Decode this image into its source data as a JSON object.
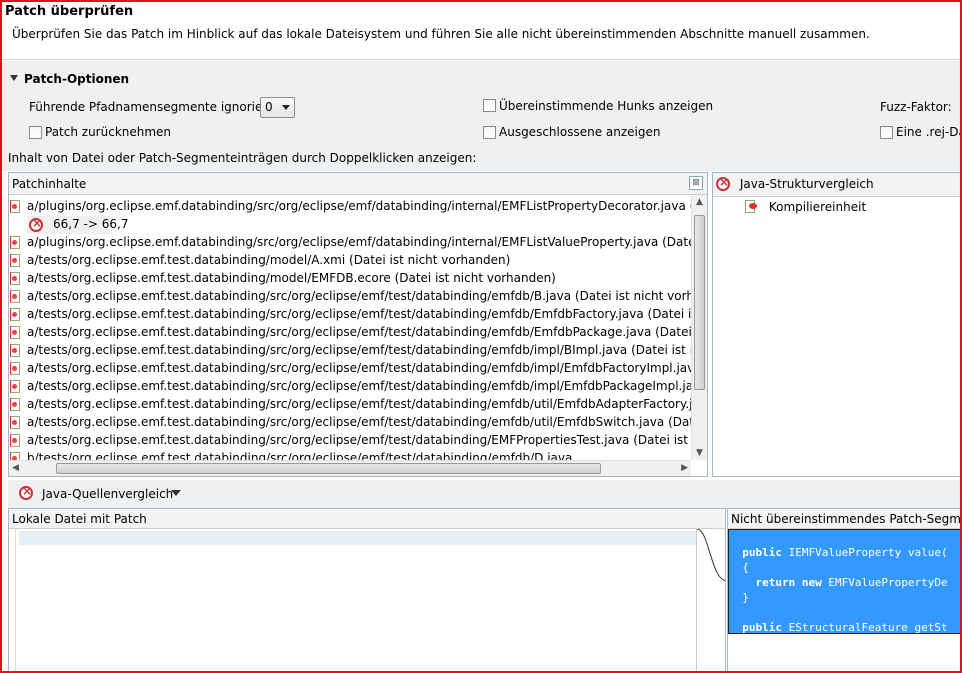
{
  "header": {
    "title": "Patch überprüfen",
    "description": "Überprüfen Sie das Patch im Hinblick auf das lokale Dateisystem und führen Sie alle nicht übereinstimmenden Abschnitte manuell zusammen."
  },
  "options": {
    "section_label": "Patch-Optionen",
    "strip_label": "Führende Pfadnamensegmente ignorieren:",
    "strip_value": "0",
    "show_matching_label": "Übereinstimmende Hunks anzeigen",
    "fuzz_label": "Fuzz-Faktor:",
    "reverse_label": "Patch zurücknehmen",
    "show_excluded_label": "Ausgeschlossene anzeigen",
    "rej_label": "Eine .rej-Date",
    "hint": "Inhalt von Datei oder Patch-Segmenteinträgen durch Doppelklicken anzeigen:"
  },
  "patch_panel": {
    "title": "Patchinhalte",
    "hunk_label": "66,7 -> 66,7",
    "files": [
      "a/plugins/org.eclipse.emf.databinding/src/org/eclipse/emf/databinding/internal/EMFListPropertyDecorator.java (Datei ist nic",
      "a/plugins/org.eclipse.emf.databinding/src/org/eclipse/emf/databinding/internal/EMFListValueProperty.java (Datei ist nicht vo",
      "a/tests/org.eclipse.emf.test.databinding/model/A.xmi (Datei ist nicht vorhanden)",
      "a/tests/org.eclipse.emf.test.databinding/model/EMFDB.ecore (Datei ist nicht vorhanden)",
      "a/tests/org.eclipse.emf.test.databinding/src/org/eclipse/emf/test/databinding/emfdb/B.java (Datei ist nicht vorhanden)",
      "a/tests/org.eclipse.emf.test.databinding/src/org/eclipse/emf/test/databinding/emfdb/EmfdbFactory.java (Datei ist nicht vorh",
      "a/tests/org.eclipse.emf.test.databinding/src/org/eclipse/emf/test/databinding/emfdb/EmfdbPackage.java (Datei ist nicht vorh",
      "a/tests/org.eclipse.emf.test.databinding/src/org/eclipse/emf/test/databinding/emfdb/impl/BImpl.java (Datei ist nicht vorhand",
      "a/tests/org.eclipse.emf.test.databinding/src/org/eclipse/emf/test/databinding/emfdb/impl/EmfdbFactoryImpl.java (Datei ist n",
      "a/tests/org.eclipse.emf.test.databinding/src/org/eclipse/emf/test/databinding/emfdb/impl/EmfdbPackageImpl.java (Datei ist",
      "a/tests/org.eclipse.emf.test.databinding/src/org/eclipse/emf/test/databinding/emfdb/util/EmfdbAdapterFactory.java (Datei is",
      "a/tests/org.eclipse.emf.test.databinding/src/org/eclipse/emf/test/databinding/emfdb/util/EmfdbSwitch.java (Datei ist nicht v",
      "a/tests/org.eclipse.emf.test.databinding/src/org/eclipse/emf/test/databinding/EMFPropertiesTest.java (Datei ist nicht vorhand",
      "b/tests/org.eclipse.emf.test.databinding/src/org/eclipse/emf/test/databinding/emfdb/D.java"
    ]
  },
  "structure_panel": {
    "title": "Java-Strukturvergleich",
    "item": "Kompiliereinheit"
  },
  "source_compare": {
    "title": "Java-Quellenvergleich",
    "left_title": "Lokale Datei mit Patch",
    "right_title": "Nicht übereinstimmendes Patch-Segment",
    "code_lines": [
      "",
      "  public IEMFValueProperty value(",
      "  {",
      "    return new EMFValuePropertyDe",
      "  }",
      "",
      "  public EStructuralFeature getSt"
    ]
  }
}
